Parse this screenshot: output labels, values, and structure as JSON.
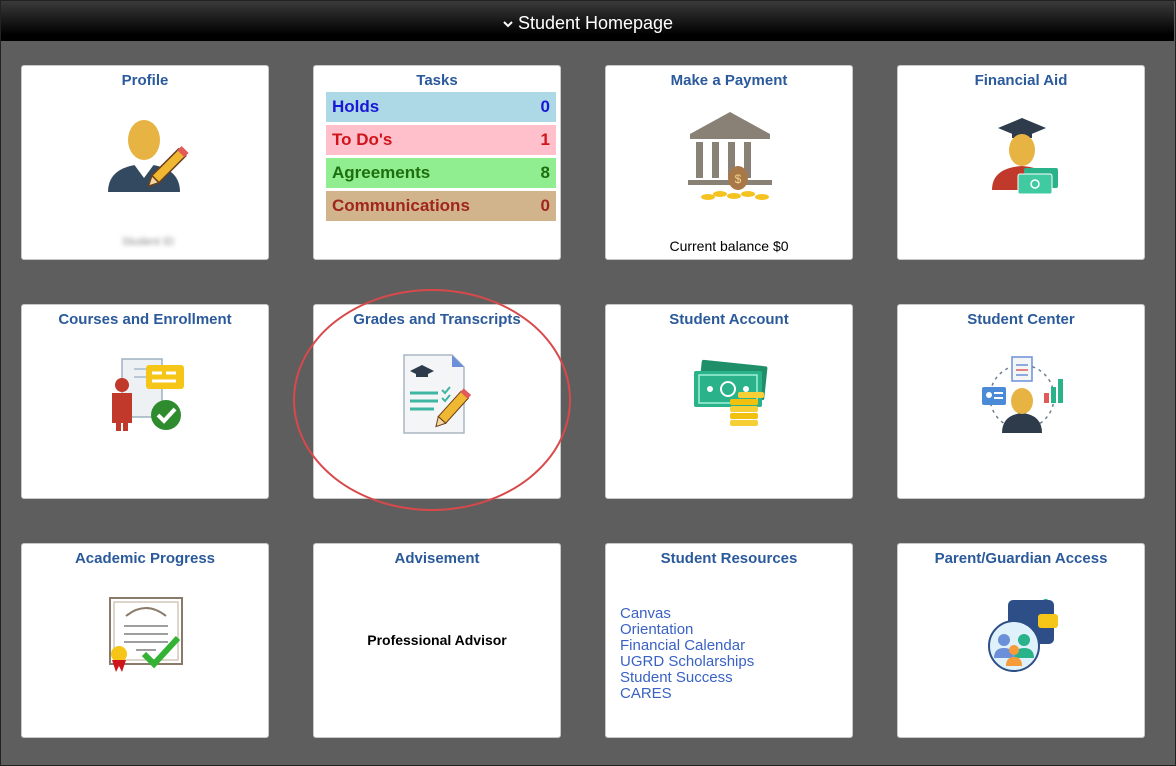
{
  "header": {
    "title": "Student Homepage",
    "chevron": "chevron-down-icon"
  },
  "tiles": {
    "profile": {
      "title": "Profile",
      "icon": "user-edit-icon",
      "caption": "Student ID"
    },
    "tasks": {
      "title": "Tasks",
      "rows": [
        {
          "label": "Holds",
          "count": "0",
          "bg": "#add8e6",
          "color": "#1a17d6"
        },
        {
          "label": "To Do's",
          "count": "1",
          "bg": "#ffc0cb",
          "color": "#d0141b"
        },
        {
          "label": "Agreements",
          "count": "8",
          "bg": "#90ee90",
          "color": "#1f6e0d"
        },
        {
          "label": "Communications",
          "count": "0",
          "bg": "#d2b48c",
          "color": "#a0251c"
        }
      ]
    },
    "payment": {
      "title": "Make a Payment",
      "icon": "bank-icon",
      "caption": "Current balance $0"
    },
    "financial_aid": {
      "title": "Financial Aid",
      "icon": "graduate-money-icon"
    },
    "courses": {
      "title": "Courses and Enrollment",
      "icon": "enrollment-icon"
    },
    "grades": {
      "title": "Grades and Transcripts",
      "icon": "transcript-icon"
    },
    "account": {
      "title": "Student Account",
      "icon": "cash-icon"
    },
    "center": {
      "title": "Student Center",
      "icon": "student-center-icon"
    },
    "progress": {
      "title": "Academic Progress",
      "icon": "diploma-icon"
    },
    "advisement": {
      "title": "Advisement",
      "caption": "Professional Advisor"
    },
    "resources": {
      "title": "Student Resources",
      "links": [
        "Canvas",
        "Orientation",
        "Financial Calendar",
        "UGRD Scholarships",
        "Student Success",
        "CARES"
      ]
    },
    "parent": {
      "title": "Parent/Guardian Access",
      "icon": "family-wallet-icon"
    }
  },
  "colors": {
    "title": "#2b5a9b",
    "link": "#3a62c4",
    "highlight": "#d9484a"
  }
}
